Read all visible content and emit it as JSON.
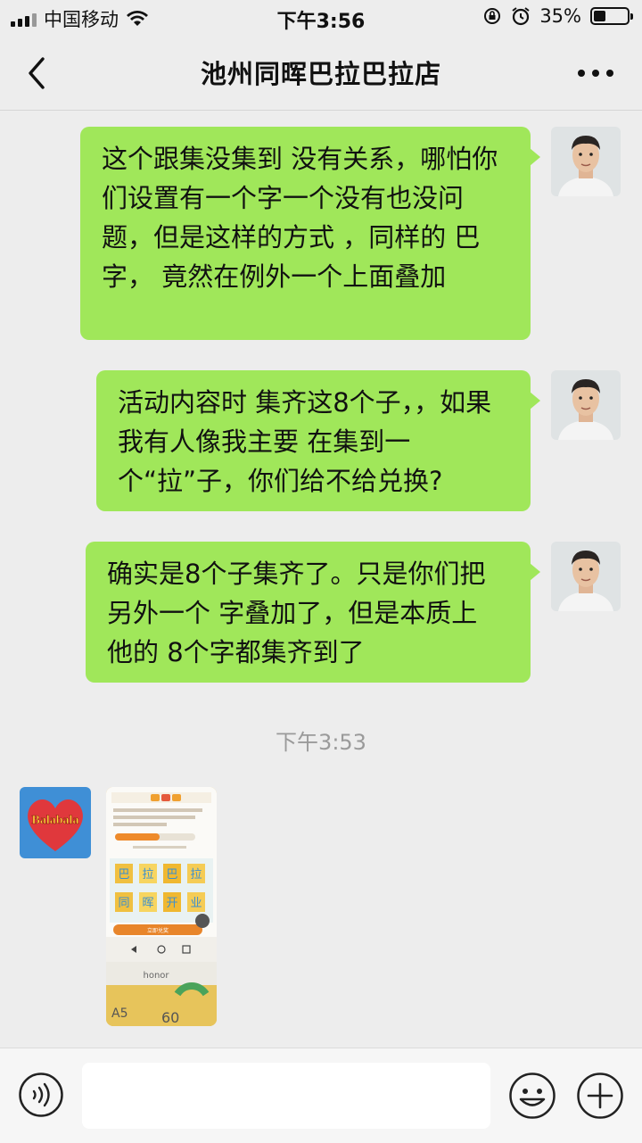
{
  "status_bar": {
    "carrier": "中国移动",
    "time": "下午3:56",
    "battery": "35%",
    "battery_level": 0.35
  },
  "header": {
    "title": "池州同晖巴拉巴拉店"
  },
  "messages": [
    {
      "text": "这个跟集没集到 没有关系，哪怕你们设置有一个字一个没有也没问题，但是这样的方式 ，同样的 巴 字， 竟然在例外一个上面叠加"
    },
    {
      "text": "活动内容时  集齐这8个子，，如果我有人像我主要 在集到一个“拉”子，你们给不给兑换?"
    },
    {
      "text": "确实是8个子集齐了。只是你们把 另外一个 字叠加了，但是本质上 他的 8个字都集齐到了"
    }
  ],
  "timestamp": "下午3:53",
  "brand_avatar": {
    "text": "Balabala"
  },
  "photo": {
    "phone_brand": "honor",
    "box_label": "A5",
    "box_number": "60",
    "tiles": [
      "巴",
      "拉",
      "巴",
      "拉",
      "同",
      "晖",
      "开",
      "业"
    ],
    "button_label": "立即兑奖"
  },
  "colors": {
    "bubble": "#a0e75a",
    "background": "#ededed",
    "input_bar": "#f6f6f6"
  }
}
